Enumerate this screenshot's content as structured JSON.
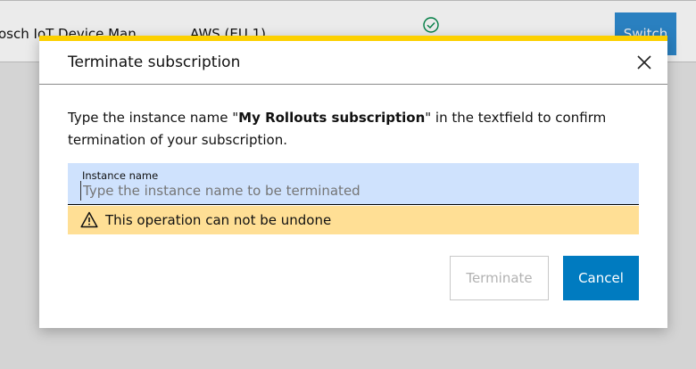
{
  "background_row": {
    "name": "osch IoT Device Man",
    "region": "AWS (EU 1)",
    "status_icon": "check-circle-icon",
    "switch_label": "Switch"
  },
  "dialog": {
    "title": "Terminate subscription",
    "close_icon": "close-icon",
    "message_prefix": "Type the instance name \"",
    "message_name": "My Rollouts subscription",
    "message_suffix": "\" in the textfield to confirm termination of your subscription.",
    "field": {
      "label": "Instance name",
      "value": "",
      "placeholder": "Type the instance name to be terminated"
    },
    "warning": {
      "icon": "warning-triangle-icon",
      "text": "This operation can not be undone"
    },
    "buttons": {
      "terminate": "Terminate",
      "cancel": "Cancel"
    }
  },
  "colors": {
    "accent_yellow": "#fcd000",
    "primary_blue": "#007bc0",
    "field_bg": "#cfe2fd",
    "warning_bg": "#ffdf95",
    "status_green": "#00884a"
  }
}
